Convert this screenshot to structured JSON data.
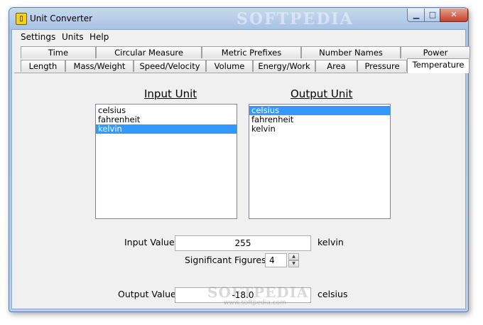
{
  "window": {
    "title": "Unit Converter",
    "icon": "calculator-icon",
    "watermark": "SOFTPEDIA",
    "controls": {
      "minimize": "▁",
      "maximize": "□",
      "close": "✕"
    }
  },
  "menubar": {
    "items": [
      "Settings",
      "Units",
      "Help"
    ]
  },
  "tabs": {
    "row_back": [
      "Time",
      "Circular Measure",
      "Metric Prefixes",
      "Number Names",
      "Power"
    ],
    "row_front": [
      "Length",
      "Mass/Weight",
      "Speed/Velocity",
      "Volume",
      "Energy/Work",
      "Area",
      "Pressure",
      "Temperature"
    ],
    "active": "Temperature"
  },
  "input_unit": {
    "header": "Input Unit",
    "items": [
      "celsius",
      "fahrenheit",
      "kelvin"
    ],
    "selected": "kelvin"
  },
  "output_unit": {
    "header": "Output Unit",
    "items": [
      "celsius",
      "fahrenheit",
      "kelvin"
    ],
    "selected": "celsius"
  },
  "input_value": {
    "label": "Input Value:",
    "value": "255",
    "unit": "kelvin"
  },
  "significant_figures": {
    "label": "Significant Figures:",
    "value": "4"
  },
  "output_value": {
    "label": "Output Value:",
    "value": "-18.0",
    "unit": "celsius"
  },
  "overlay": {
    "watermark": "SOFTPEDIA",
    "url": "www.softpedia.com"
  }
}
